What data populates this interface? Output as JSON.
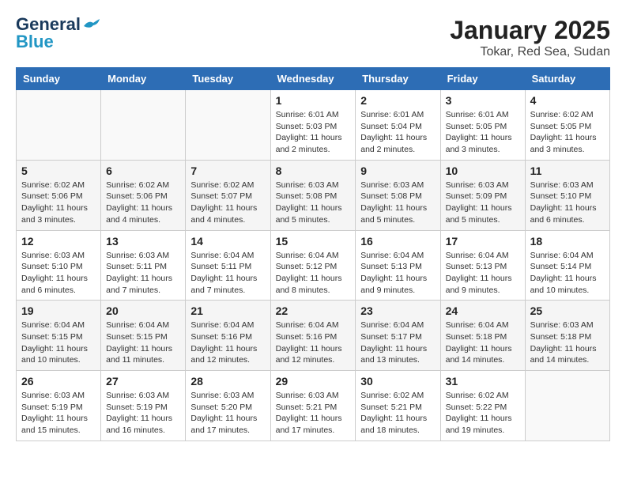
{
  "logo": {
    "general": "General",
    "blue": "Blue"
  },
  "title": "January 2025",
  "subtitle": "Tokar, Red Sea, Sudan",
  "days_of_week": [
    "Sunday",
    "Monday",
    "Tuesday",
    "Wednesday",
    "Thursday",
    "Friday",
    "Saturday"
  ],
  "weeks": [
    [
      {
        "day": "",
        "info": ""
      },
      {
        "day": "",
        "info": ""
      },
      {
        "day": "",
        "info": ""
      },
      {
        "day": "1",
        "info": "Sunrise: 6:01 AM\nSunset: 5:03 PM\nDaylight: 11 hours and 2 minutes."
      },
      {
        "day": "2",
        "info": "Sunrise: 6:01 AM\nSunset: 5:04 PM\nDaylight: 11 hours and 2 minutes."
      },
      {
        "day": "3",
        "info": "Sunrise: 6:01 AM\nSunset: 5:05 PM\nDaylight: 11 hours and 3 minutes."
      },
      {
        "day": "4",
        "info": "Sunrise: 6:02 AM\nSunset: 5:05 PM\nDaylight: 11 hours and 3 minutes."
      }
    ],
    [
      {
        "day": "5",
        "info": "Sunrise: 6:02 AM\nSunset: 5:06 PM\nDaylight: 11 hours and 3 minutes."
      },
      {
        "day": "6",
        "info": "Sunrise: 6:02 AM\nSunset: 5:06 PM\nDaylight: 11 hours and 4 minutes."
      },
      {
        "day": "7",
        "info": "Sunrise: 6:02 AM\nSunset: 5:07 PM\nDaylight: 11 hours and 4 minutes."
      },
      {
        "day": "8",
        "info": "Sunrise: 6:03 AM\nSunset: 5:08 PM\nDaylight: 11 hours and 5 minutes."
      },
      {
        "day": "9",
        "info": "Sunrise: 6:03 AM\nSunset: 5:08 PM\nDaylight: 11 hours and 5 minutes."
      },
      {
        "day": "10",
        "info": "Sunrise: 6:03 AM\nSunset: 5:09 PM\nDaylight: 11 hours and 5 minutes."
      },
      {
        "day": "11",
        "info": "Sunrise: 6:03 AM\nSunset: 5:10 PM\nDaylight: 11 hours and 6 minutes."
      }
    ],
    [
      {
        "day": "12",
        "info": "Sunrise: 6:03 AM\nSunset: 5:10 PM\nDaylight: 11 hours and 6 minutes."
      },
      {
        "day": "13",
        "info": "Sunrise: 6:03 AM\nSunset: 5:11 PM\nDaylight: 11 hours and 7 minutes."
      },
      {
        "day": "14",
        "info": "Sunrise: 6:04 AM\nSunset: 5:11 PM\nDaylight: 11 hours and 7 minutes."
      },
      {
        "day": "15",
        "info": "Sunrise: 6:04 AM\nSunset: 5:12 PM\nDaylight: 11 hours and 8 minutes."
      },
      {
        "day": "16",
        "info": "Sunrise: 6:04 AM\nSunset: 5:13 PM\nDaylight: 11 hours and 9 minutes."
      },
      {
        "day": "17",
        "info": "Sunrise: 6:04 AM\nSunset: 5:13 PM\nDaylight: 11 hours and 9 minutes."
      },
      {
        "day": "18",
        "info": "Sunrise: 6:04 AM\nSunset: 5:14 PM\nDaylight: 11 hours and 10 minutes."
      }
    ],
    [
      {
        "day": "19",
        "info": "Sunrise: 6:04 AM\nSunset: 5:15 PM\nDaylight: 11 hours and 10 minutes."
      },
      {
        "day": "20",
        "info": "Sunrise: 6:04 AM\nSunset: 5:15 PM\nDaylight: 11 hours and 11 minutes."
      },
      {
        "day": "21",
        "info": "Sunrise: 6:04 AM\nSunset: 5:16 PM\nDaylight: 11 hours and 12 minutes."
      },
      {
        "day": "22",
        "info": "Sunrise: 6:04 AM\nSunset: 5:16 PM\nDaylight: 11 hours and 12 minutes."
      },
      {
        "day": "23",
        "info": "Sunrise: 6:04 AM\nSunset: 5:17 PM\nDaylight: 11 hours and 13 minutes."
      },
      {
        "day": "24",
        "info": "Sunrise: 6:04 AM\nSunset: 5:18 PM\nDaylight: 11 hours and 14 minutes."
      },
      {
        "day": "25",
        "info": "Sunrise: 6:03 AM\nSunset: 5:18 PM\nDaylight: 11 hours and 14 minutes."
      }
    ],
    [
      {
        "day": "26",
        "info": "Sunrise: 6:03 AM\nSunset: 5:19 PM\nDaylight: 11 hours and 15 minutes."
      },
      {
        "day": "27",
        "info": "Sunrise: 6:03 AM\nSunset: 5:19 PM\nDaylight: 11 hours and 16 minutes."
      },
      {
        "day": "28",
        "info": "Sunrise: 6:03 AM\nSunset: 5:20 PM\nDaylight: 11 hours and 17 minutes."
      },
      {
        "day": "29",
        "info": "Sunrise: 6:03 AM\nSunset: 5:21 PM\nDaylight: 11 hours and 17 minutes."
      },
      {
        "day": "30",
        "info": "Sunrise: 6:02 AM\nSunset: 5:21 PM\nDaylight: 11 hours and 18 minutes."
      },
      {
        "day": "31",
        "info": "Sunrise: 6:02 AM\nSunset: 5:22 PM\nDaylight: 11 hours and 19 minutes."
      },
      {
        "day": "",
        "info": ""
      }
    ]
  ]
}
